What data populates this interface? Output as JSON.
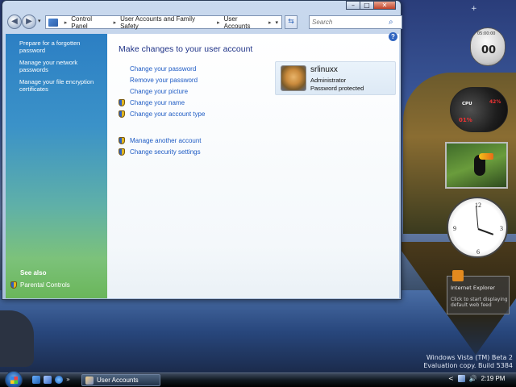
{
  "window": {
    "address": {
      "crumbs": [
        "Control Panel",
        "User Accounts and Family Safety",
        "User Accounts"
      ]
    },
    "search_placeholder": "Search",
    "caption": {
      "minimize": "–",
      "maximize": "□",
      "close": "✕"
    }
  },
  "sidepane": {
    "tasks": [
      "Prepare for a forgotten password",
      "Manage your network passwords",
      "Manage your file encryption certificates"
    ],
    "see_also_label": "See also",
    "see_also_link": "Parental Controls"
  },
  "content": {
    "title": "Make changes to your user account",
    "links": [
      {
        "label": "Change your password",
        "shield": false
      },
      {
        "label": "Remove your password",
        "shield": false
      },
      {
        "label": "Change your picture",
        "shield": false
      },
      {
        "label": "Change your name",
        "shield": true
      },
      {
        "label": "Change your account type",
        "shield": true
      }
    ],
    "links2": [
      {
        "label": "Manage another account",
        "shield": true
      },
      {
        "label": "Change security settings",
        "shield": true
      }
    ],
    "user": {
      "name": "srlinuxx",
      "role": "Administrator",
      "status": "Password protected"
    },
    "help": "?"
  },
  "gadgets": {
    "sidebar_add": "+",
    "timer_label": "05:00:00",
    "timer_value": "00",
    "cpu_label": "CPU",
    "cpu_value": "01%",
    "mem_value": "42%",
    "clock_numbers": [
      "12",
      "3",
      "6",
      "9"
    ],
    "feed_title": "Internet Explorer",
    "feed_text": "Click to start displaying default web feed"
  },
  "desktop": {
    "watermark_line1": "Windows Vista (TM) Beta 2",
    "watermark_line2": "Evaluation copy. Build 5384"
  },
  "taskbar": {
    "task_label": "User Accounts",
    "quicklaunch_more": "»",
    "tray_expand": "<",
    "time": "2:19 PM"
  },
  "colors": {
    "link": "#1e5bc4",
    "title": "#1e3287",
    "sidepane_top": "#2c7fc4",
    "sidepane_bottom": "#6ab65a"
  }
}
